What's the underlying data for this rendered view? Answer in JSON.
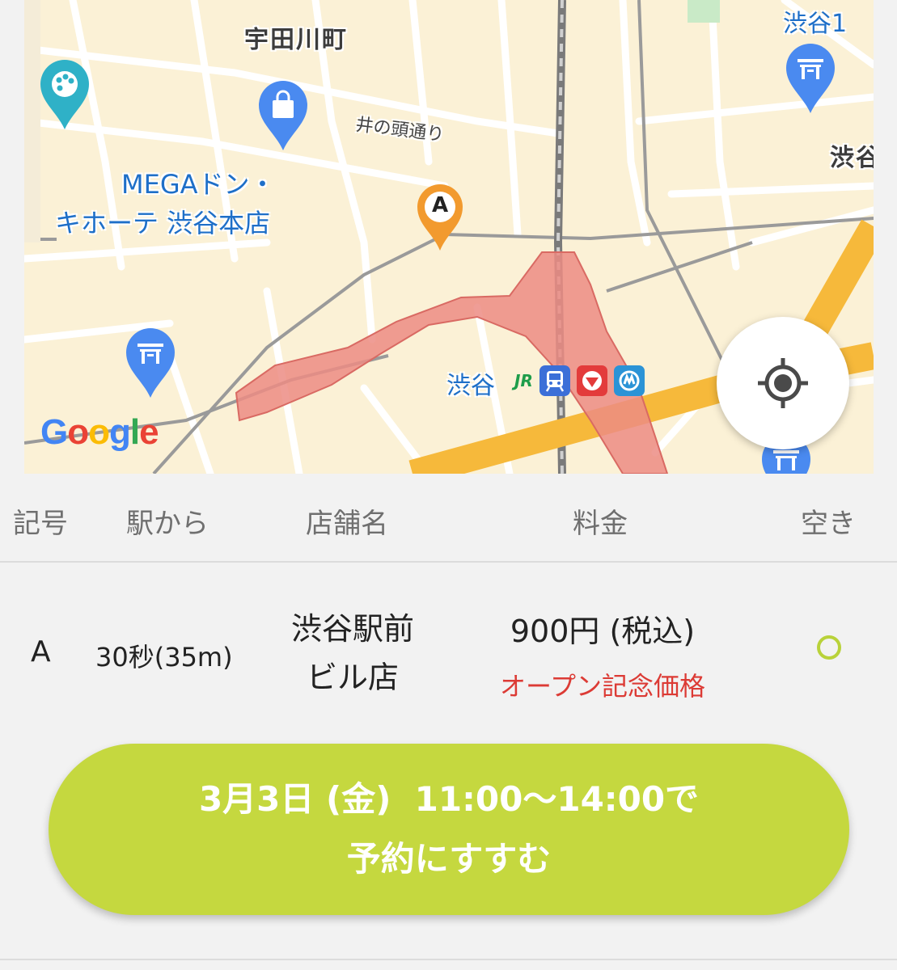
{
  "map": {
    "area_label": "宇田川町",
    "street_label": "井の頭通り",
    "place_name_line1": "MEGAドン・",
    "place_name_line2": "キホーテ 渋谷本店",
    "station_label": "渋谷",
    "jr_label": "JR",
    "edge_label_top": "渋谷1",
    "edge_label_right": "渋谷",
    "marker_letter": "A",
    "google_letters": [
      "G",
      "o",
      "o",
      "g",
      "l",
      "e"
    ],
    "google_colors": [
      "#4285f4",
      "#ea4335",
      "#fbbc05",
      "#4285f4",
      "#34a853",
      "#ea4335"
    ],
    "accent_marker": "#f29a2e",
    "highlight_color": "#ec8c84",
    "icons": [
      "palette-pin-icon",
      "shopping-bag-pin-icon",
      "torii-gate-pin-icon",
      "my-location-icon"
    ]
  },
  "table": {
    "headers": {
      "code": "記号",
      "distance": "駅から",
      "store": "店舗名",
      "price": "料金",
      "availability": "空き"
    },
    "row": {
      "code": "A",
      "distance": "30秒(35m)",
      "store_line1": "渋谷駅前",
      "store_line2": "ビル店",
      "price": "900円 (税込)",
      "price_note": "オープン記念価格",
      "availability": "available"
    }
  },
  "reserve": {
    "line1": "3月3日 (金)  11:00〜14:00で",
    "line2": "予約にすすむ",
    "color": "#c5d83f"
  }
}
